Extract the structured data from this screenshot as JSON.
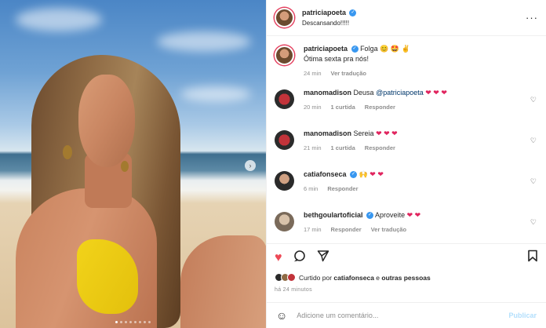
{
  "post": {
    "author": "patriciapoeta",
    "caption": "Descansando!!!!!",
    "more_icon": "more-options-icon"
  },
  "comments": [
    {
      "user": "patriciapoeta",
      "verified": true,
      "text": "Folga",
      "emojis": "😊 🤩 ✌",
      "text2": "Ótima sexta pra nós!",
      "time": "24 min",
      "likes": "",
      "actions": [
        "Ver tradução"
      ]
    },
    {
      "user": "manomadison",
      "verified": false,
      "text": "Deusa ",
      "mention": "@patriciapoeta",
      "hearts": "❤ ❤ ❤",
      "time": "20 min",
      "likes": "1 curtida",
      "actions": [
        "Responder"
      ]
    },
    {
      "user": "manomadison",
      "verified": false,
      "text": "Sereia ",
      "hearts": "❤ ❤ ❤",
      "time": "21 min",
      "likes": "1 curtida",
      "actions": [
        "Responder"
      ]
    },
    {
      "user": "catiafonseca",
      "verified": true,
      "text": "🙌 ",
      "hearts": "❤ ❤",
      "time": "6 min",
      "likes": "",
      "actions": [
        "Responder"
      ]
    },
    {
      "user": "bethgoulartoficial",
      "verified": true,
      "text": "Aproveite ",
      "hearts": "❤ ❤",
      "time": "17 min",
      "likes": "",
      "actions": [
        "Responder",
        "Ver tradução"
      ]
    }
  ],
  "liked_by": {
    "prefix": "Curtido por ",
    "user": "catiafonseca",
    "mid": " e ",
    "others": "outras pessoas"
  },
  "timestamp": "há 24 minutos",
  "comment_box": {
    "placeholder": "Adicione um comentário...",
    "publish_label": "Publicar"
  },
  "colors": {
    "like": "#ed4956",
    "verified": "#3897f0",
    "publish": "#b2dffc"
  }
}
